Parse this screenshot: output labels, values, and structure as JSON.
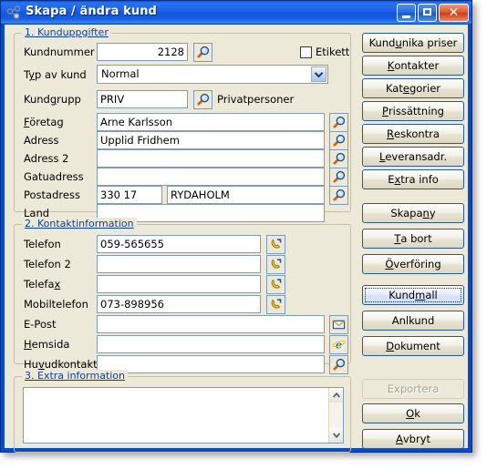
{
  "window": {
    "title": "Skapa / ändra kund",
    "icon": "network-nodes-icon",
    "controls": {
      "minimize": "minimize-button",
      "maximize": "maximize-button",
      "close": "close-button"
    }
  },
  "section1": {
    "title": "1. Kunduppgifter",
    "fields": {
      "kundnummer_label": "Kundnummer",
      "kundnummer_value": "2128",
      "etikett_label": "Etikett",
      "etikett_checked": false,
      "typ_label": "Typ av kund",
      "typ_value": "Normal",
      "kundgrupp_label": "Kundgrupp",
      "kundgrupp_value": "PRIV",
      "kundgrupp_desc": "Privatpersoner",
      "foretag_label": "Företag",
      "foretag_value": "Arne Karlsson",
      "adress_label": "Adress",
      "adress_value": "Upplid Fridhem",
      "adress2_label": "Adress 2",
      "adress2_value": "",
      "gatuadress_label": "Gatuadress",
      "gatuadress_value": "",
      "postadress_label": "Postadress",
      "postnummer_value": "330 17",
      "ort_value": "RYDAHOLM",
      "land_label": "Land",
      "land_value": ""
    }
  },
  "section2": {
    "title": "2. Kontaktinformation",
    "fields": {
      "telefon_label": "Telefon",
      "telefon_value": "059-565655",
      "telefon2_label": "Telefon 2",
      "telefon2_value": "",
      "telefax_label": "Telefax",
      "telefax_value": "",
      "mobil_label": "Mobiltelefon",
      "mobil_value": "073-898956",
      "epost_label": "E-Post",
      "epost_value": "",
      "hemsida_label": "Hemsida",
      "hemsida_value": "",
      "huvudkontakt_label": "Huvudkontakt",
      "huvudkontakt_value": ""
    }
  },
  "section3": {
    "title": "3. Extra information",
    "memo_value": ""
  },
  "buttons": {
    "kundunika_priser": "Kundunika priser",
    "kontakter": "Kontakter",
    "kategorier": "Kategorier",
    "prissattning": "Prissättning",
    "reskontra": "Reskontra",
    "leveransadr": "Leveransadr.",
    "extra_info": "Extra info",
    "skapa_ny": "Skapa ny",
    "ta_bort": "Ta bort",
    "overforing": "Överföring",
    "kundmall": "Kundmall",
    "anlkund": "Anlkund",
    "dokument": "Dokument",
    "exportera": "Exportera",
    "ok": "Ok",
    "avbryt": "Avbryt"
  },
  "colors": {
    "titlebar_blue": "#0f55dd",
    "dialog_face": "#ece9d8",
    "group_title_blue": "#0b3fa8",
    "field_border": "#7f9db9",
    "button_border": "#2b5797",
    "close_red": "#c8401a"
  }
}
